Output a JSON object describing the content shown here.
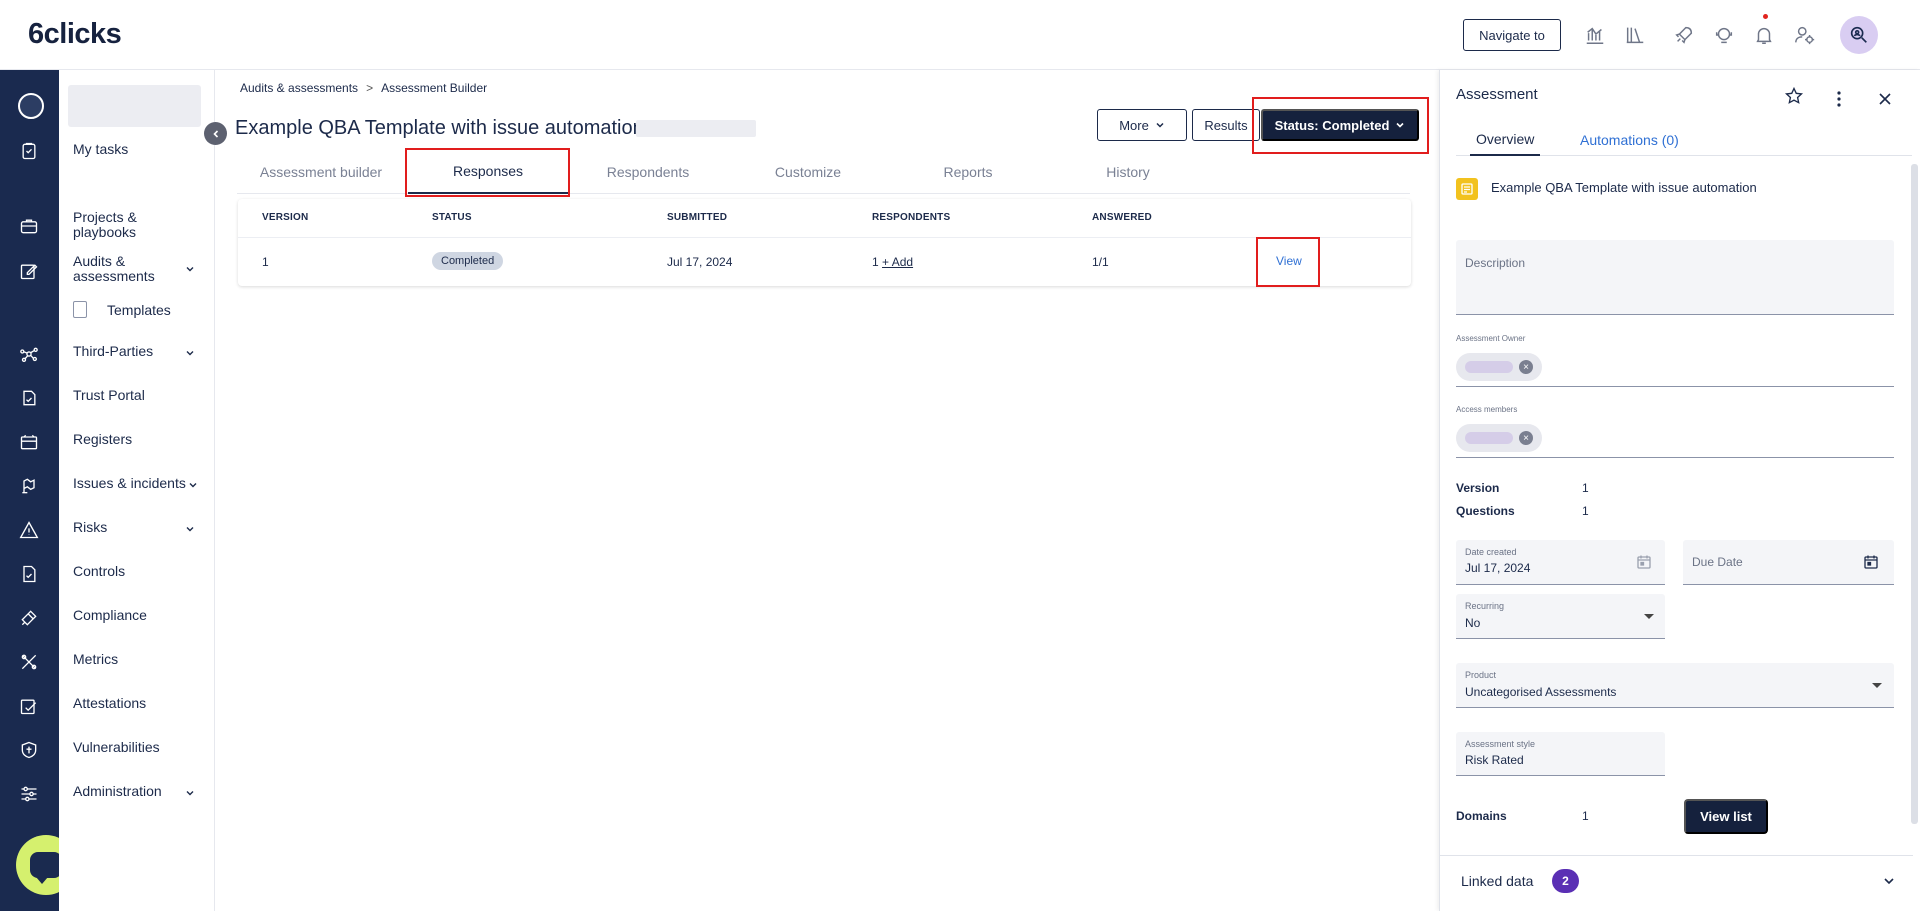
{
  "topbar": {
    "logo": "6clicks",
    "navigate_label": "Navigate to",
    "icons": [
      "analytics-icon",
      "library-icon",
      "rocket-icon",
      "support-icon",
      "bell-icon",
      "user-settings-icon"
    ],
    "avatar_icon": "profile-search-icon"
  },
  "rail": {
    "icons": [
      "avatar",
      "tasks-icon",
      "briefcase-icon",
      "edit-icon",
      "network-icon",
      "portal-icon",
      "register-icon",
      "issue-icon",
      "risk-icon",
      "controls-icon",
      "compliance-icon",
      "metrics-icon",
      "attestation-icon",
      "shield-icon",
      "admin-icon"
    ],
    "chat_icon": "chat-icon"
  },
  "sidebar": {
    "items": [
      {
        "label": "My tasks"
      },
      {
        "label": "Projects & playbooks"
      },
      {
        "label": "Audits & assessments"
      },
      {
        "label": "Third-Parties"
      },
      {
        "label": "Trust Portal"
      },
      {
        "label": "Registers"
      },
      {
        "label": "Issues & incidents"
      },
      {
        "label": "Risks"
      },
      {
        "label": "Controls"
      },
      {
        "label": "Compliance"
      },
      {
        "label": "Metrics"
      },
      {
        "label": "Attestations"
      },
      {
        "label": "Vulnerabilities"
      },
      {
        "label": "Administration"
      }
    ],
    "sub_item": "Templates"
  },
  "breadcrumb": {
    "parent": "Audits & assessments",
    "separator": ">",
    "current": "Assessment Builder"
  },
  "page": {
    "title": "Example QBA Template with issue automation",
    "more_label": "More",
    "results_label": "Results",
    "status_label": "Status: Completed"
  },
  "tabs": [
    {
      "label": "Assessment builder"
    },
    {
      "label": "Responses"
    },
    {
      "label": "Respondents"
    },
    {
      "label": "Customize"
    },
    {
      "label": "Reports"
    },
    {
      "label": "History"
    }
  ],
  "active_tab": "Responses",
  "table": {
    "headers": [
      "VERSION",
      "STATUS",
      "SUBMITTED",
      "RESPONDENTS",
      "ANSWERED"
    ],
    "rows": [
      {
        "version": "1",
        "status": "Completed",
        "submitted": "Jul 17, 2024",
        "respondents": "1",
        "add_label": "+ Add",
        "answered": "1/1",
        "action": "View"
      }
    ]
  },
  "panel": {
    "title": "Assessment",
    "tabs": [
      "Overview",
      "Automations (0)"
    ],
    "name": "Example QBA Template with issue automation",
    "description_placeholder": "Description",
    "owner_label": "Assessment Owner",
    "members_label": "Access members",
    "version_label": "Version",
    "version_value": "1",
    "questions_label": "Questions",
    "questions_value": "1",
    "date_created_label": "Date created",
    "date_created_value": "Jul 17, 2024",
    "due_date_placeholder": "Due Date",
    "recurring_label": "Recurring",
    "recurring_value": "No",
    "product_label": "Product",
    "product_value": "Uncategorised Assessments",
    "style_label": "Assessment style",
    "style_value": "Risk Rated",
    "domains_label": "Domains",
    "domains_value": "1",
    "view_list_label": "View list",
    "linked_label": "Linked data",
    "linked_count": "2"
  },
  "colors": {
    "navy": "#15213d",
    "rail": "#1a2a4f",
    "highlight": "#e11d1d",
    "link": "#2f70d4",
    "accent_purple": "#5a2fb4",
    "chat_green": "#d5f06e"
  }
}
